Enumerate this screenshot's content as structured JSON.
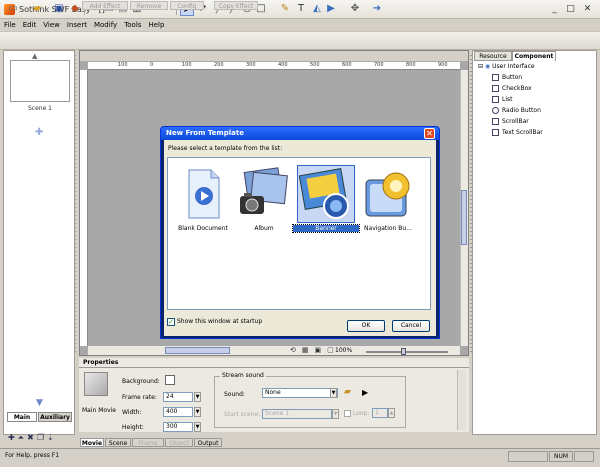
{
  "window": {
    "title": "Sothink SWF Easy - []",
    "buttons": {
      "minimize": "_",
      "maximize": "□",
      "close": "✕"
    }
  },
  "menu": [
    "File",
    "Edit",
    "View",
    "Insert",
    "Modify",
    "Tools",
    "Help"
  ],
  "toolbar": {
    "icons": [
      "new-icon",
      "open-icon",
      "save-icon",
      "publish-icon",
      "cut-icon",
      "copy-icon",
      "paste-icon",
      "delete-icon",
      "undo-icon",
      "redo-icon",
      "select-icon",
      "subselect-icon",
      "line-icon",
      "oval-icon",
      "rectangle-icon",
      "pen-icon",
      "text-icon",
      "fill-icon",
      "gradient-icon",
      "pick-color-icon",
      "effect-icon"
    ]
  },
  "context_buttons": [
    "Add Effect",
    "Remove",
    "Config",
    "Copy Effect"
  ],
  "left_panel": {
    "scene_label": "Scene 1",
    "tabs": [
      "Main",
      "Auxiliary"
    ]
  },
  "ruler": {
    "ticks": [
      "100",
      "0",
      "100",
      "200",
      "300",
      "400",
      "500",
      "600",
      "700",
      "800",
      "900"
    ]
  },
  "stage": {
    "zoom": "100%"
  },
  "right_panel": {
    "tabs": [
      "Resource",
      "Component"
    ],
    "active_tab": "Component",
    "root": "User Interface",
    "items": [
      "Button",
      "CheckBox",
      "List",
      "Radio Button",
      "ScrollBar",
      "Text ScrollBar"
    ]
  },
  "dialog": {
    "title": "New From Template",
    "prompt": "Please select a template from the list:",
    "templates": [
      {
        "label": "Blank Document",
        "selected": false
      },
      {
        "label": "Album",
        "selected": false
      },
      {
        "label": "Banner",
        "selected": true
      },
      {
        "label": "Navigation Bu...",
        "selected": false
      }
    ],
    "show_at_startup": "Show this window at startup",
    "show_at_startup_checked": true,
    "ok": "OK",
    "cancel": "Cancel"
  },
  "properties": {
    "title": "Properties",
    "object": "Main Movie",
    "background_label": "Background:",
    "frame_rate_label": "Frame rate:",
    "frame_rate": "24",
    "width_label": "Width:",
    "width": "400",
    "height_label": "Height:",
    "height": "300",
    "stream_group": "Stream sound",
    "sound_label": "Sound:",
    "sound_value": "None",
    "start_scene_label": "Start scene:",
    "start_scene_value": "Scene 1",
    "loop_label": "Loop:",
    "loop_value": "1"
  },
  "bottom_tabs": [
    "Movie",
    "Scene",
    "Frame",
    "Object",
    "Output"
  ],
  "status": {
    "text": "For Help, press F1",
    "cells": [
      "",
      "NUM",
      ""
    ]
  }
}
